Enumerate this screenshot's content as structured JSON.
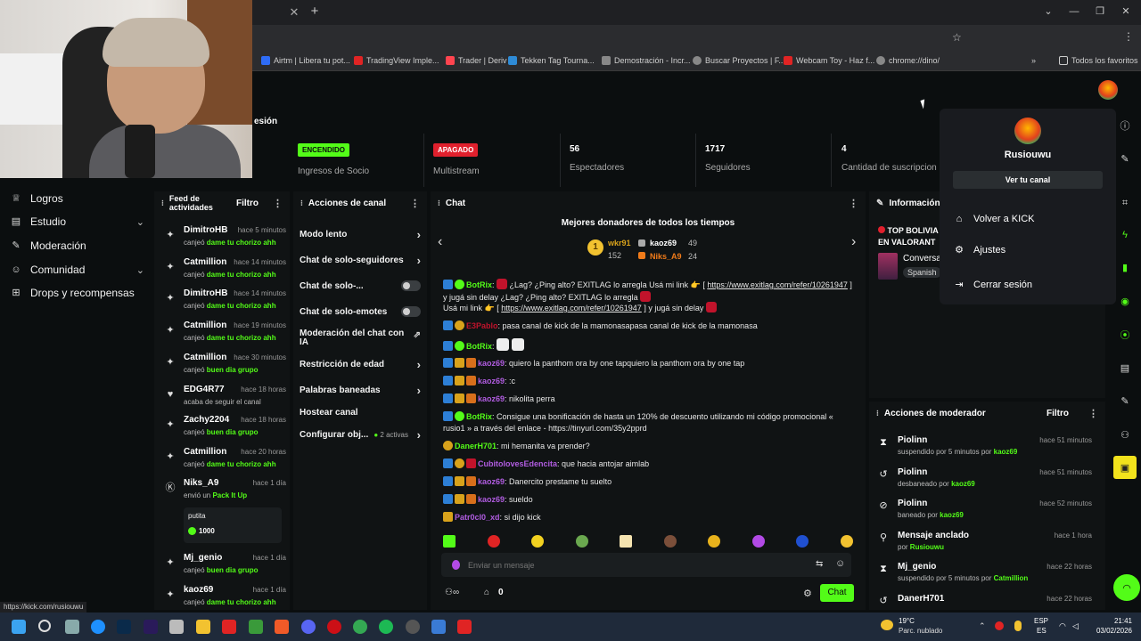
{
  "browser": {
    "bookmarks": [
      {
        "label": "Airtm | Libera tu pot...",
        "color": "#2e6cf6"
      },
      {
        "label": "TradingView Imple...",
        "color": "#e02424"
      },
      {
        "label": "Trader | Deriv",
        "color": "#ff444f"
      },
      {
        "label": "Tekken Tag Tourna...",
        "color": "#2e8bd6"
      },
      {
        "label": "Demostración - Incr...",
        "color": "#888888"
      },
      {
        "label": "Buscar Proyectos | F...",
        "color": "#888888"
      },
      {
        "label": "Webcam Toy - Haz f...",
        "color": "#e02424"
      },
      {
        "label": "chrome://dino/",
        "color": "#888888"
      }
    ],
    "all_bookmarks": "Todos los favoritos",
    "status_url": "https://kick.com/rusiouwu"
  },
  "header": {
    "title_fragment": "esión"
  },
  "left_nav": {
    "items": [
      {
        "label": "Logros",
        "icon": "trophy-icon",
        "chevron": false
      },
      {
        "label": "Estudio",
        "icon": "studio-icon",
        "chevron": true
      },
      {
        "label": "Moderación",
        "icon": "wrench-icon",
        "chevron": false
      },
      {
        "label": "Comunidad",
        "icon": "community-icon",
        "chevron": true
      },
      {
        "label": "Drops y recompensas",
        "icon": "drops-icon",
        "chevron": false
      }
    ]
  },
  "stats": {
    "socio_pill": "ENCENDIDO",
    "socio_label": "Ingresos de Socio",
    "multistream_pill": "APAGADO",
    "multistream_label": "Multistream",
    "viewers": "56",
    "viewers_label": "Espectadores",
    "followers": "1717",
    "followers_label": "Seguidores",
    "subs": "4",
    "subs_label": "Cantidad de suscripcion"
  },
  "feed": {
    "title": "Feed de actividades",
    "filter": "Filtro",
    "items": [
      {
        "user": "DimitroHB",
        "time": "hace 5 minutos",
        "desc": "canjeó ",
        "reward": "dame tu chorizo ahh",
        "icon": "reward-icon"
      },
      {
        "user": "Catmillion",
        "time": "hace 14 minutos",
        "desc": "canjeó ",
        "reward": "dame tu chorizo ahh",
        "icon": "reward-icon"
      },
      {
        "user": "DimitroHB",
        "time": "hace 14 minutos",
        "desc": "canjeó ",
        "reward": "dame tu chorizo ahh",
        "icon": "reward-icon"
      },
      {
        "user": "Catmillion",
        "time": "hace 19 minutos",
        "desc": "canjeó ",
        "reward": "dame tu chorizo ahh",
        "icon": "reward-icon"
      },
      {
        "user": "Catmillion",
        "time": "hace 30 minutos",
        "desc": "canjeó ",
        "reward": "buen dia grupo",
        "icon": "reward-icon"
      },
      {
        "user": "EDG4R77",
        "time": "hace 18 horas",
        "desc": "acaba de seguir el canal",
        "reward": "",
        "icon": "heart-icon"
      },
      {
        "user": "Zachy2204",
        "time": "hace 18 horas",
        "desc": "canjeó ",
        "reward": "buen dia grupo",
        "icon": "reward-icon"
      },
      {
        "user": "Catmillion",
        "time": "hace 20 horas",
        "desc": "canjeó ",
        "reward": "dame tu chorizo ahh",
        "icon": "reward-icon"
      },
      {
        "user": "Niks_A9",
        "time": "hace 1 día",
        "desc": "envió un ",
        "reward": "Pack It Up",
        "icon": "kick-icon"
      },
      {
        "user": "Mj_genio",
        "time": "hace 1 día",
        "desc": "canjeó ",
        "reward": "buen dia grupo",
        "icon": "reward-icon"
      },
      {
        "user": "kaoz69",
        "time": "hace 1 día",
        "desc": "canjeó ",
        "reward": "dame tu chorizo ahh",
        "icon": "reward-icon"
      }
    ],
    "gift_message": "putita",
    "gift_amount": "1000"
  },
  "channel_actions": {
    "title": "Acciones de canal",
    "items": [
      {
        "label": "Modo lento",
        "control": "arrow"
      },
      {
        "label": "Chat de solo-seguidores",
        "control": "arrow"
      },
      {
        "label": "Chat de solo-...",
        "control": "toggle"
      },
      {
        "label": "Chat de solo-emotes",
        "control": "toggle"
      },
      {
        "label": "Moderación del chat con IA",
        "control": "external"
      },
      {
        "label": "Restricción de edad",
        "control": "arrow"
      },
      {
        "label": "Palabras baneadas",
        "control": "arrow"
      },
      {
        "label": "Hostear canal",
        "control": "none"
      },
      {
        "label": "Configurar obj...",
        "control": "arrow",
        "extra": "2 activas"
      }
    ]
  },
  "chat": {
    "title": "Chat",
    "donors_title": "Mejores donadores de todos los tiempos",
    "donors": [
      {
        "name": "wkr91",
        "value": "49",
        "color": "#d8a21b"
      },
      {
        "name": "kaoz69",
        "value": "",
        "color": "#ffffff"
      },
      {
        "name": "152",
        "value": "",
        "color": "#bbbbbb"
      },
      {
        "name": "Niks_A9",
        "value": "24",
        "color": "#f07b1a"
      }
    ],
    "messages": [
      {
        "user": "BotRix",
        "color": "#53fc18",
        "text": "¿Lag? ¿Ping alto? EXITLAG lo arregla  Usá mi link 👉 [ ",
        "link": "https://www.exitlag.com/refer/10261947",
        "tail": " ] y jugá sin delay  ¿Lag? ¿Ping alto? EXITLAG lo arregla"
      },
      {
        "user": "",
        "color": "#e8e8e8",
        "text": "Usá mi link 👉 [ ",
        "link": "https://www.exitlag.com/refer/10261947",
        "tail": " ] y jugá sin delay"
      },
      {
        "user": "E3Pablo",
        "color": "#c1132b",
        "text": "pasa canal de kick de la mamonasapasa canal de kick de la mamonasa",
        "link": "",
        "tail": ""
      },
      {
        "user": "BotRix",
        "color": "#53fc18",
        "text": "",
        "link": "",
        "tail": ""
      },
      {
        "user": "kaoz69",
        "color": "#b05ce0",
        "text": "quiero la panthom ora by one tapquiero la panthom ora by one tap",
        "link": "",
        "tail": ""
      },
      {
        "user": "kaoz69",
        "color": "#b05ce0",
        "text": ":c",
        "link": "",
        "tail": ""
      },
      {
        "user": "kaoz69",
        "color": "#b05ce0",
        "text": "nikolita perra",
        "link": "",
        "tail": ""
      },
      {
        "user": "BotRix",
        "color": "#53fc18",
        "text": "Consigue una bonificación de hasta un 120% de descuento utilizando mi código promocional « rusio1 » a través del enlace - https://tinyurl.com/35y2pprd",
        "link": "",
        "tail": ""
      },
      {
        "user": "DanerH701",
        "color": "#53fc18",
        "text": "mi hemanita va prender?",
        "link": "",
        "tail": ""
      },
      {
        "user": "CubitolovesEdencita",
        "color": "#b05ce0",
        "text": "que hacia antojar aimlab",
        "link": "",
        "tail": ""
      },
      {
        "user": "kaoz69",
        "color": "#b05ce0",
        "text": "Danercito prestame tu suelto",
        "link": "",
        "tail": ""
      },
      {
        "user": "kaoz69",
        "color": "#b05ce0",
        "text": "sueldo",
        "link": "",
        "tail": ""
      },
      {
        "user": "Patr0cl0_xd",
        "color": "#b05ce0",
        "text": "si dijo kick",
        "link": "",
        "tail": ""
      }
    ],
    "input_placeholder": "Enviar un mensaje",
    "points": "0",
    "send_label": "Chat"
  },
  "info": {
    "title": "Información",
    "stream_title": "TOP BOLIVIA EN VALORANT",
    "category": "Conversa",
    "language": "Spanish"
  },
  "mod_actions": {
    "title": "Acciones de moderador",
    "filter": "Filtro",
    "items": [
      {
        "user": "Piolinn",
        "time": "hace 51 minutos",
        "desc": "suspendido por 5 minutos por ",
        "by": "kaoz69",
        "icon": "hourglass-icon"
      },
      {
        "user": "Piolinn",
        "time": "hace 51 minutos",
        "desc": "desbaneado por ",
        "by": "kaoz69",
        "icon": "undo-icon"
      },
      {
        "user": "Piolinn",
        "time": "hace 52 minutos",
        "desc": "baneado por ",
        "by": "kaoz69",
        "icon": "ban-icon"
      },
      {
        "user": "Mensaje anclado",
        "time": "hace 1 hora",
        "desc": "por ",
        "by": "Rusiouwu",
        "icon": "pin-icon"
      },
      {
        "user": "Mj_genio",
        "time": "hace 22 horas",
        "desc": "suspendido por 5 minutos por ",
        "by": "Catmillion",
        "icon": "hourglass-icon"
      },
      {
        "user": "DanerH701",
        "time": "hace 22 horas",
        "desc": "",
        "by": "",
        "icon": "undo-icon"
      }
    ]
  },
  "dropdown": {
    "username": "Rusiouwu",
    "view_channel": "Ver tu canal",
    "back": "Volver a KICK",
    "settings": "Ajustes",
    "logout": "Cerrar sesión"
  },
  "taskbar": {
    "temp": "19°C",
    "weather": "Parc. nublado",
    "lang1": "ESP",
    "lang2": "ES",
    "time": "21:41",
    "date": "03/02/2026"
  },
  "colors": {
    "accent": "#53fc18",
    "danger": "#e0202d",
    "panel": "#101314",
    "bg": "#0b0e0f"
  }
}
